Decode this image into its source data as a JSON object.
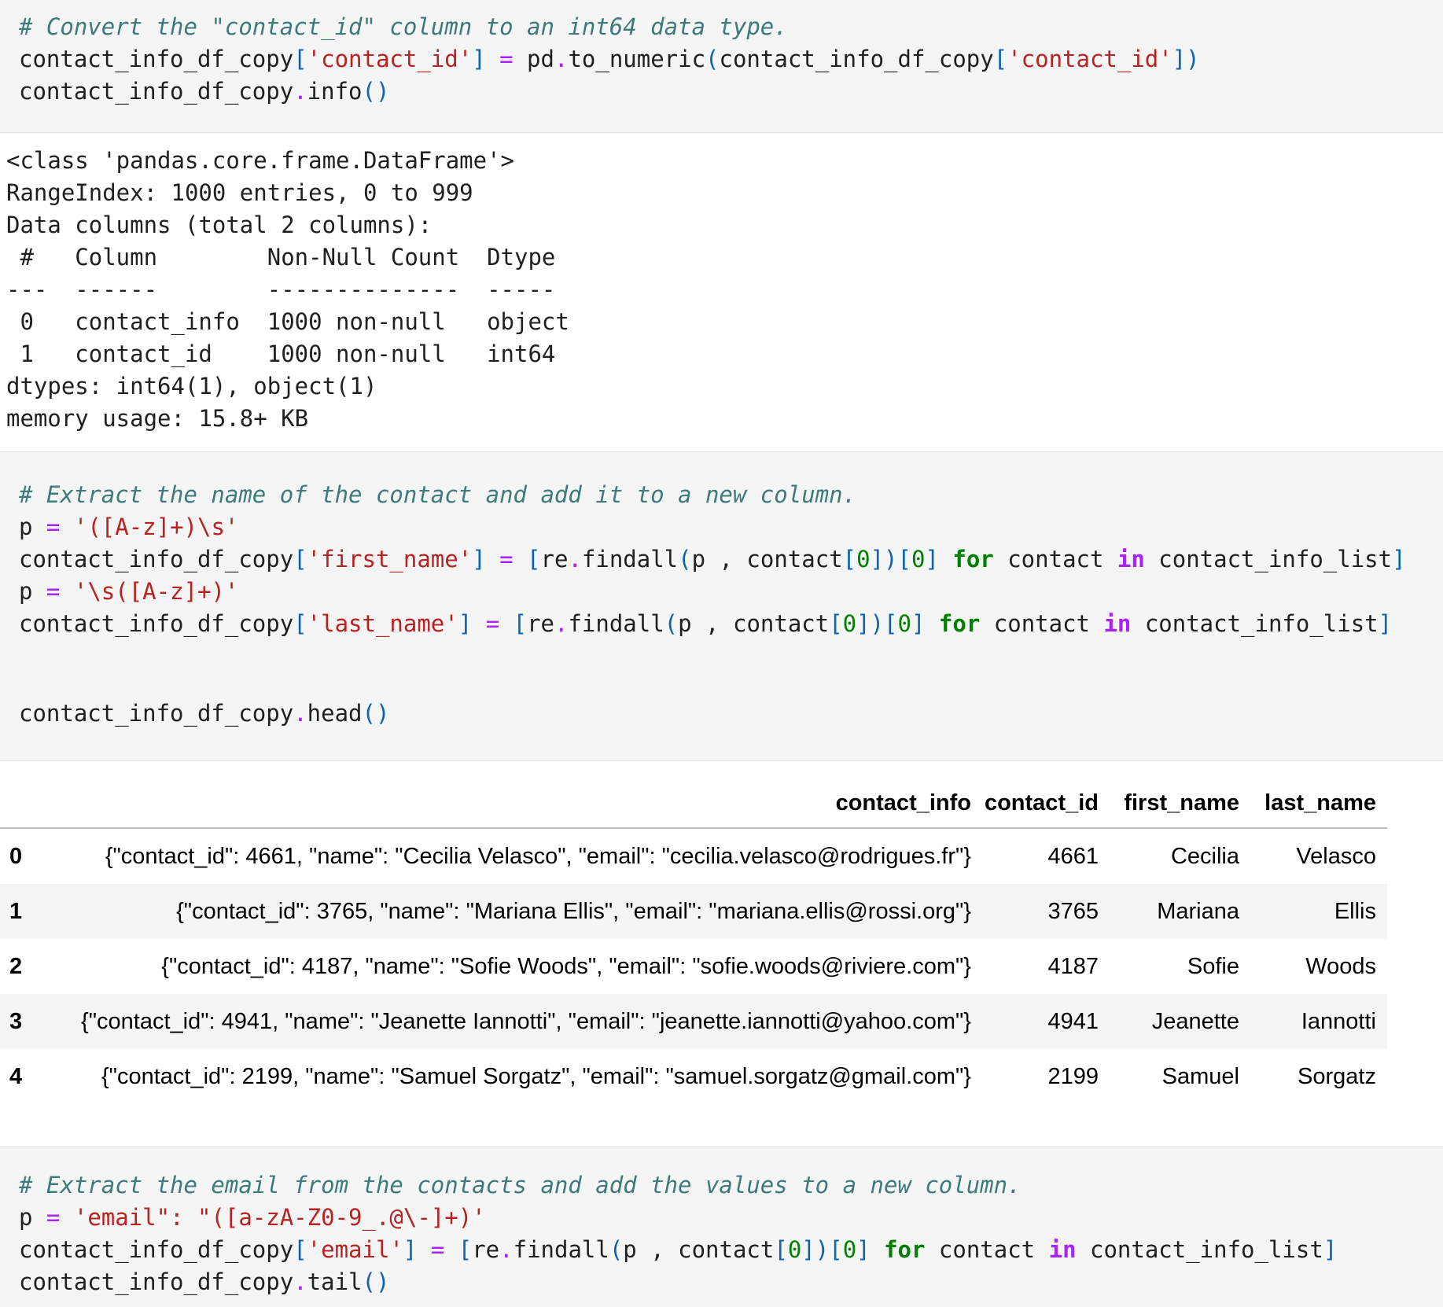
{
  "cell1": {
    "comment": "# Convert the \"contact_id\" column to an int64 data type.",
    "line2": {
      "a": "contact_info_df_copy",
      "b": "[",
      "c": "'contact_id'",
      "d": "]",
      "e": " = ",
      "f": "pd",
      "g": ".",
      "h": "to_numeric",
      "i": "(",
      "j": "contact_info_df_copy",
      "k": "[",
      "l": "'contact_id'",
      "m": "]",
      "n": ")"
    },
    "line3": {
      "a": "contact_info_df_copy",
      "b": ".",
      "c": "info",
      "d": "()"
    }
  },
  "output1": {
    "lines": [
      "<class 'pandas.core.frame.DataFrame'>",
      "RangeIndex: 1000 entries, 0 to 999",
      "Data columns (total 2 columns):",
      " #   Column        Non-Null Count  Dtype ",
      "---  ------        --------------  ----- ",
      " 0   contact_info  1000 non-null   object",
      " 1   contact_id    1000 non-null   int64 ",
      "dtypes: int64(1), object(1)",
      "memory usage: 15.8+ KB"
    ]
  },
  "cell2": {
    "comment": "# Extract the name of the contact and add it to a new column.",
    "p1": {
      "var": "p",
      "eq": " = ",
      "str": "'([A-z]+)\\s'"
    },
    "l2": {
      "a": "contact_info_df_copy",
      "b": "[",
      "c": "'first_name'",
      "d": "]",
      "e": " = ",
      "f": "[",
      "g": "re",
      "h": ".",
      "i": "findall",
      "j": "(",
      "k": "p , contact",
      "l": "[",
      "m": "0",
      "n": "])[",
      "o": "0",
      "p": "] ",
      "q": "for",
      "r": " contact ",
      "s": "in",
      "t": " contact_info_list",
      "u": "]"
    },
    "p2": {
      "var": "p",
      "eq": " = ",
      "str": "'\\s([A-z]+)'"
    },
    "l4": {
      "a": "contact_info_df_copy",
      "b": "[",
      "c": "'last_name'",
      "d": "]",
      "e": " = ",
      "f": "[",
      "g": "re",
      "h": ".",
      "i": "findall",
      "j": "(",
      "k": "p , contact",
      "l": "[",
      "m": "0",
      "n": "])[",
      "o": "0",
      "p": "] ",
      "q": "for",
      "r": " contact ",
      "s": "in",
      "t": " contact_info_list",
      "u": "]"
    },
    "l5": {
      "a": "contact_info_df_copy",
      "b": ".",
      "c": "head",
      "d": "()"
    }
  },
  "table": {
    "columns": [
      "",
      "contact_info",
      "contact_id",
      "first_name",
      "last_name"
    ],
    "rows": [
      {
        "index": "0",
        "contact_info": "{\"contact_id\": 4661, \"name\": \"Cecilia Velasco\", \"email\": \"cecilia.velasco@rodrigues.fr\"}",
        "contact_id": "4661",
        "first_name": "Cecilia",
        "last_name": "Velasco"
      },
      {
        "index": "1",
        "contact_info": "{\"contact_id\": 3765, \"name\": \"Mariana Ellis\", \"email\": \"mariana.ellis@rossi.org\"}",
        "contact_id": "3765",
        "first_name": "Mariana",
        "last_name": "Ellis"
      },
      {
        "index": "2",
        "contact_info": "{\"contact_id\": 4187, \"name\": \"Sofie Woods\", \"email\": \"sofie.woods@riviere.com\"}",
        "contact_id": "4187",
        "first_name": "Sofie",
        "last_name": "Woods"
      },
      {
        "index": "3",
        "contact_info": "{\"contact_id\": 4941, \"name\": \"Jeanette Iannotti\", \"email\": \"jeanette.iannotti@yahoo.com\"}",
        "contact_id": "4941",
        "first_name": "Jeanette",
        "last_name": "Iannotti"
      },
      {
        "index": "4",
        "contact_info": "{\"contact_id\": 2199, \"name\": \"Samuel Sorgatz\", \"email\": \"samuel.sorgatz@gmail.com\"}",
        "contact_id": "2199",
        "first_name": "Samuel",
        "last_name": "Sorgatz"
      }
    ]
  },
  "cell3": {
    "comment": "# Extract the email from the contacts and add the values to a new column.",
    "p1": {
      "var": "p",
      "eq": " = ",
      "str": "'email\": \"([a-zA-Z0-9_.@\\-]+)'"
    },
    "l2": {
      "a": "contact_info_df_copy",
      "b": "[",
      "c": "'email'",
      "d": "]",
      "e": " = ",
      "f": "[",
      "g": "re",
      "h": ".",
      "i": "findall",
      "j": "(",
      "k": "p , contact",
      "l": "[",
      "m": "0",
      "n": "])[",
      "o": "0",
      "p": "] ",
      "q": "for",
      "r": " contact ",
      "s": "in",
      "t": " contact_info_list",
      "u": "]"
    },
    "l3": {
      "a": "contact_info_df_copy",
      "b": ".",
      "c": "tail",
      "d": "()"
    }
  },
  "colors": {
    "comment": "#3d7a7a",
    "string": "#ba2121",
    "keyword": "#008000",
    "operator": "#aa22ff",
    "bracket": "#0b63b3",
    "number": "#008000",
    "code_bg": "#f5f5f5"
  }
}
